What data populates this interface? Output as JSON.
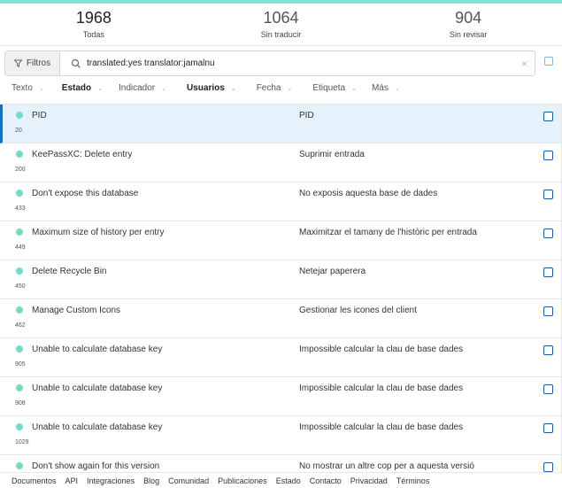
{
  "stats": [
    {
      "count": "1968",
      "label": "Todas"
    },
    {
      "count": "1064",
      "label": "Sin traducir"
    },
    {
      "count": "904",
      "label": "Sin revisar"
    }
  ],
  "filter": {
    "button_label": "Filtros",
    "query": "translated:yes translator:jamalnu",
    "clear_icon": "×"
  },
  "sort": [
    {
      "label": "Texto",
      "bold": false
    },
    {
      "label": "Estado",
      "bold": true
    },
    {
      "label": "Indicador",
      "bold": false
    },
    {
      "label": "Usuarios",
      "bold": true
    },
    {
      "label": "Fecha",
      "bold": false
    },
    {
      "label": "Etiqueta",
      "bold": false
    },
    {
      "label": "Más",
      "bold": false
    }
  ],
  "rows": [
    {
      "id": "20",
      "source": "PID",
      "target": "PID",
      "selected": true
    },
    {
      "id": "200",
      "source": "KeePassXC: Delete entry",
      "target": "Suprimir entrada"
    },
    {
      "id": "433",
      "source": "Don't expose this database",
      "target": "No exposis aquesta base de dades"
    },
    {
      "id": "449",
      "source": "Maximum size of history per entry",
      "target": "Maximitzar el tamany de l'històric per entrada"
    },
    {
      "id": "450",
      "source": "Delete Recycle Bin",
      "target": "Netejar paperera"
    },
    {
      "id": "462",
      "source": "Manage Custom Icons",
      "target": "Gestionar les icones del client"
    },
    {
      "id": "905",
      "source": "Unable to calculate database key",
      "target": "Impossible calcular la clau de base dades"
    },
    {
      "id": "908",
      "source": "Unable to calculate database key",
      "target": "Impossible calcular la clau de base dades"
    },
    {
      "id": "1029",
      "source": "Unable to calculate database key",
      "target": "Impossible calcular la clau de base dades"
    },
    {
      "id": "",
      "source": "Don't show again for this version",
      "target": "No mostrar un altre cop per a aquesta versió"
    }
  ],
  "footer": [
    "Documentos",
    "API",
    "Integraciones",
    "Blog",
    "Comunidad",
    "Publicaciones",
    "Estado",
    "Contacto",
    "Privacidad",
    "Términos"
  ],
  "colors": {
    "accent": "#7fe3d2",
    "status_dot": "#73dcc6",
    "selected_border": "#1a6fb5"
  }
}
